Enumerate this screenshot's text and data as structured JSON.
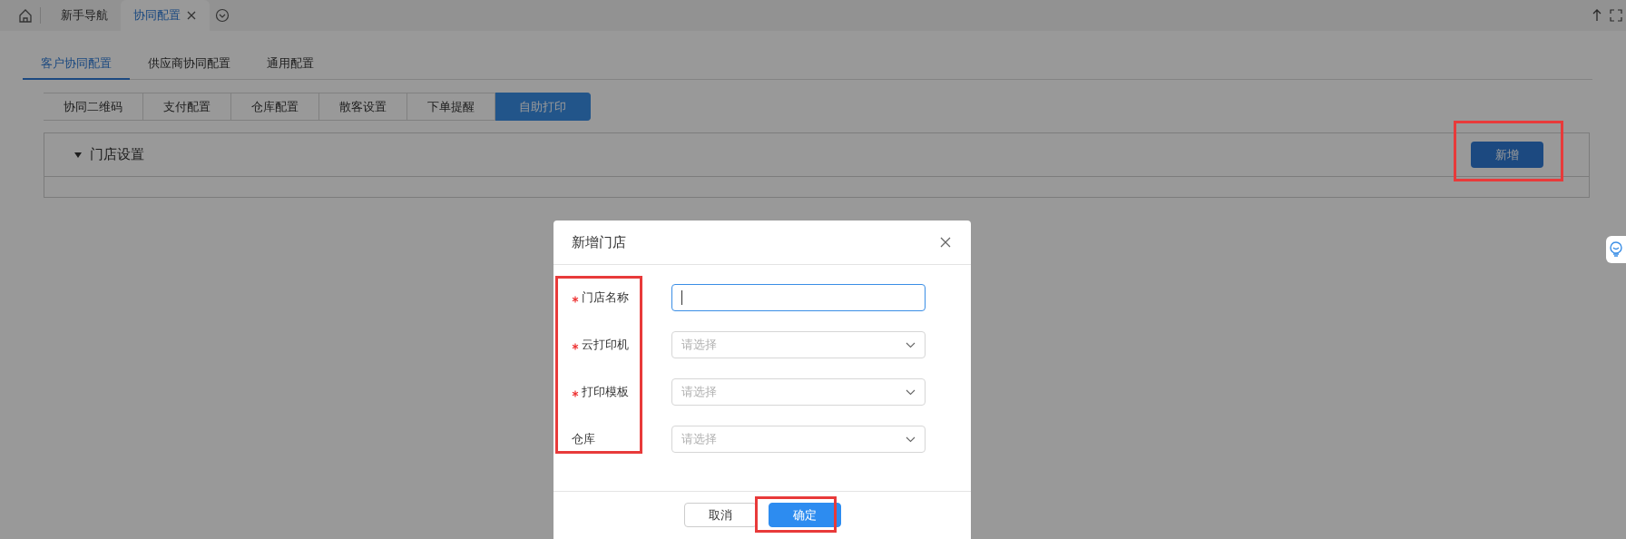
{
  "top_tabs": [
    {
      "label": "新手导航",
      "selected": false,
      "closable": false
    },
    {
      "label": "协同配置",
      "selected": true,
      "closable": true
    }
  ],
  "sub_tabs": [
    {
      "label": "客户协同配置",
      "selected": true
    },
    {
      "label": "供应商协同配置",
      "selected": false
    },
    {
      "label": "通用配置",
      "selected": false
    }
  ],
  "segments": [
    {
      "label": "协同二维码",
      "selected": false
    },
    {
      "label": "支付配置",
      "selected": false
    },
    {
      "label": "仓库配置",
      "selected": false
    },
    {
      "label": "散客设置",
      "selected": false
    },
    {
      "label": "下单提醒",
      "selected": false
    },
    {
      "label": "自助打印",
      "selected": true
    }
  ],
  "panel": {
    "title": "门店设置",
    "expanded": true,
    "add_button": "新增"
  },
  "dialog": {
    "title": "新增门店",
    "fields": [
      {
        "label": "门店名称",
        "required": true,
        "kind": "text",
        "focused": true
      },
      {
        "label": "云打印机",
        "required": true,
        "kind": "select",
        "placeholder": "请选择"
      },
      {
        "label": "打印模板",
        "required": true,
        "kind": "select",
        "placeholder": "请选择"
      },
      {
        "label": "仓库",
        "required": false,
        "kind": "select",
        "placeholder": "请选择"
      }
    ],
    "buttons": [
      {
        "label": "取消",
        "kind": "secondary"
      },
      {
        "label": "确定",
        "kind": "primary"
      }
    ]
  }
}
